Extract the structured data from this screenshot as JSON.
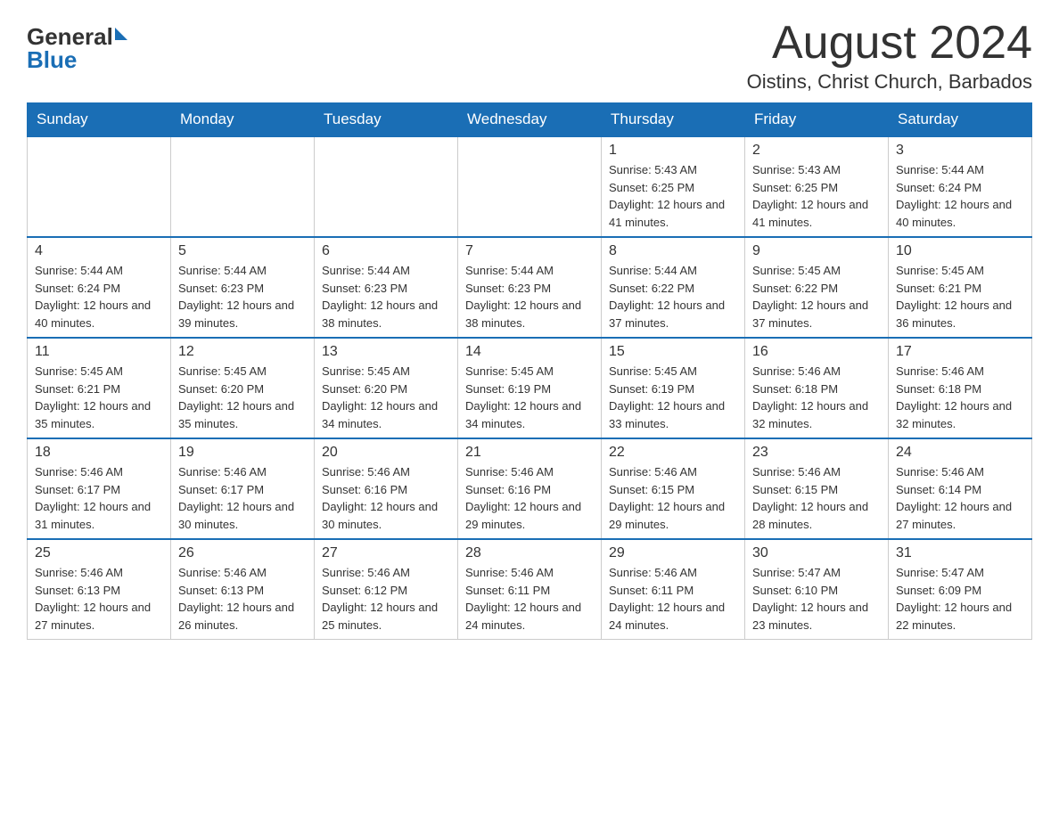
{
  "logo": {
    "text_general": "General",
    "text_blue": "Blue",
    "arrow": "▶"
  },
  "header": {
    "month_year": "August 2024",
    "location": "Oistins, Christ Church, Barbados"
  },
  "days_of_week": [
    "Sunday",
    "Monday",
    "Tuesday",
    "Wednesday",
    "Thursday",
    "Friday",
    "Saturday"
  ],
  "weeks": [
    [
      {
        "day": "",
        "info": ""
      },
      {
        "day": "",
        "info": ""
      },
      {
        "day": "",
        "info": ""
      },
      {
        "day": "",
        "info": ""
      },
      {
        "day": "1",
        "info": "Sunrise: 5:43 AM\nSunset: 6:25 PM\nDaylight: 12 hours and 41 minutes."
      },
      {
        "day": "2",
        "info": "Sunrise: 5:43 AM\nSunset: 6:25 PM\nDaylight: 12 hours and 41 minutes."
      },
      {
        "day": "3",
        "info": "Sunrise: 5:44 AM\nSunset: 6:24 PM\nDaylight: 12 hours and 40 minutes."
      }
    ],
    [
      {
        "day": "4",
        "info": "Sunrise: 5:44 AM\nSunset: 6:24 PM\nDaylight: 12 hours and 40 minutes."
      },
      {
        "day": "5",
        "info": "Sunrise: 5:44 AM\nSunset: 6:23 PM\nDaylight: 12 hours and 39 minutes."
      },
      {
        "day": "6",
        "info": "Sunrise: 5:44 AM\nSunset: 6:23 PM\nDaylight: 12 hours and 38 minutes."
      },
      {
        "day": "7",
        "info": "Sunrise: 5:44 AM\nSunset: 6:23 PM\nDaylight: 12 hours and 38 minutes."
      },
      {
        "day": "8",
        "info": "Sunrise: 5:44 AM\nSunset: 6:22 PM\nDaylight: 12 hours and 37 minutes."
      },
      {
        "day": "9",
        "info": "Sunrise: 5:45 AM\nSunset: 6:22 PM\nDaylight: 12 hours and 37 minutes."
      },
      {
        "day": "10",
        "info": "Sunrise: 5:45 AM\nSunset: 6:21 PM\nDaylight: 12 hours and 36 minutes."
      }
    ],
    [
      {
        "day": "11",
        "info": "Sunrise: 5:45 AM\nSunset: 6:21 PM\nDaylight: 12 hours and 35 minutes."
      },
      {
        "day": "12",
        "info": "Sunrise: 5:45 AM\nSunset: 6:20 PM\nDaylight: 12 hours and 35 minutes."
      },
      {
        "day": "13",
        "info": "Sunrise: 5:45 AM\nSunset: 6:20 PM\nDaylight: 12 hours and 34 minutes."
      },
      {
        "day": "14",
        "info": "Sunrise: 5:45 AM\nSunset: 6:19 PM\nDaylight: 12 hours and 34 minutes."
      },
      {
        "day": "15",
        "info": "Sunrise: 5:45 AM\nSunset: 6:19 PM\nDaylight: 12 hours and 33 minutes."
      },
      {
        "day": "16",
        "info": "Sunrise: 5:46 AM\nSunset: 6:18 PM\nDaylight: 12 hours and 32 minutes."
      },
      {
        "day": "17",
        "info": "Sunrise: 5:46 AM\nSunset: 6:18 PM\nDaylight: 12 hours and 32 minutes."
      }
    ],
    [
      {
        "day": "18",
        "info": "Sunrise: 5:46 AM\nSunset: 6:17 PM\nDaylight: 12 hours and 31 minutes."
      },
      {
        "day": "19",
        "info": "Sunrise: 5:46 AM\nSunset: 6:17 PM\nDaylight: 12 hours and 30 minutes."
      },
      {
        "day": "20",
        "info": "Sunrise: 5:46 AM\nSunset: 6:16 PM\nDaylight: 12 hours and 30 minutes."
      },
      {
        "day": "21",
        "info": "Sunrise: 5:46 AM\nSunset: 6:16 PM\nDaylight: 12 hours and 29 minutes."
      },
      {
        "day": "22",
        "info": "Sunrise: 5:46 AM\nSunset: 6:15 PM\nDaylight: 12 hours and 29 minutes."
      },
      {
        "day": "23",
        "info": "Sunrise: 5:46 AM\nSunset: 6:15 PM\nDaylight: 12 hours and 28 minutes."
      },
      {
        "day": "24",
        "info": "Sunrise: 5:46 AM\nSunset: 6:14 PM\nDaylight: 12 hours and 27 minutes."
      }
    ],
    [
      {
        "day": "25",
        "info": "Sunrise: 5:46 AM\nSunset: 6:13 PM\nDaylight: 12 hours and 27 minutes."
      },
      {
        "day": "26",
        "info": "Sunrise: 5:46 AM\nSunset: 6:13 PM\nDaylight: 12 hours and 26 minutes."
      },
      {
        "day": "27",
        "info": "Sunrise: 5:46 AM\nSunset: 6:12 PM\nDaylight: 12 hours and 25 minutes."
      },
      {
        "day": "28",
        "info": "Sunrise: 5:46 AM\nSunset: 6:11 PM\nDaylight: 12 hours and 24 minutes."
      },
      {
        "day": "29",
        "info": "Sunrise: 5:46 AM\nSunset: 6:11 PM\nDaylight: 12 hours and 24 minutes."
      },
      {
        "day": "30",
        "info": "Sunrise: 5:47 AM\nSunset: 6:10 PM\nDaylight: 12 hours and 23 minutes."
      },
      {
        "day": "31",
        "info": "Sunrise: 5:47 AM\nSunset: 6:09 PM\nDaylight: 12 hours and 22 minutes."
      }
    ]
  ]
}
